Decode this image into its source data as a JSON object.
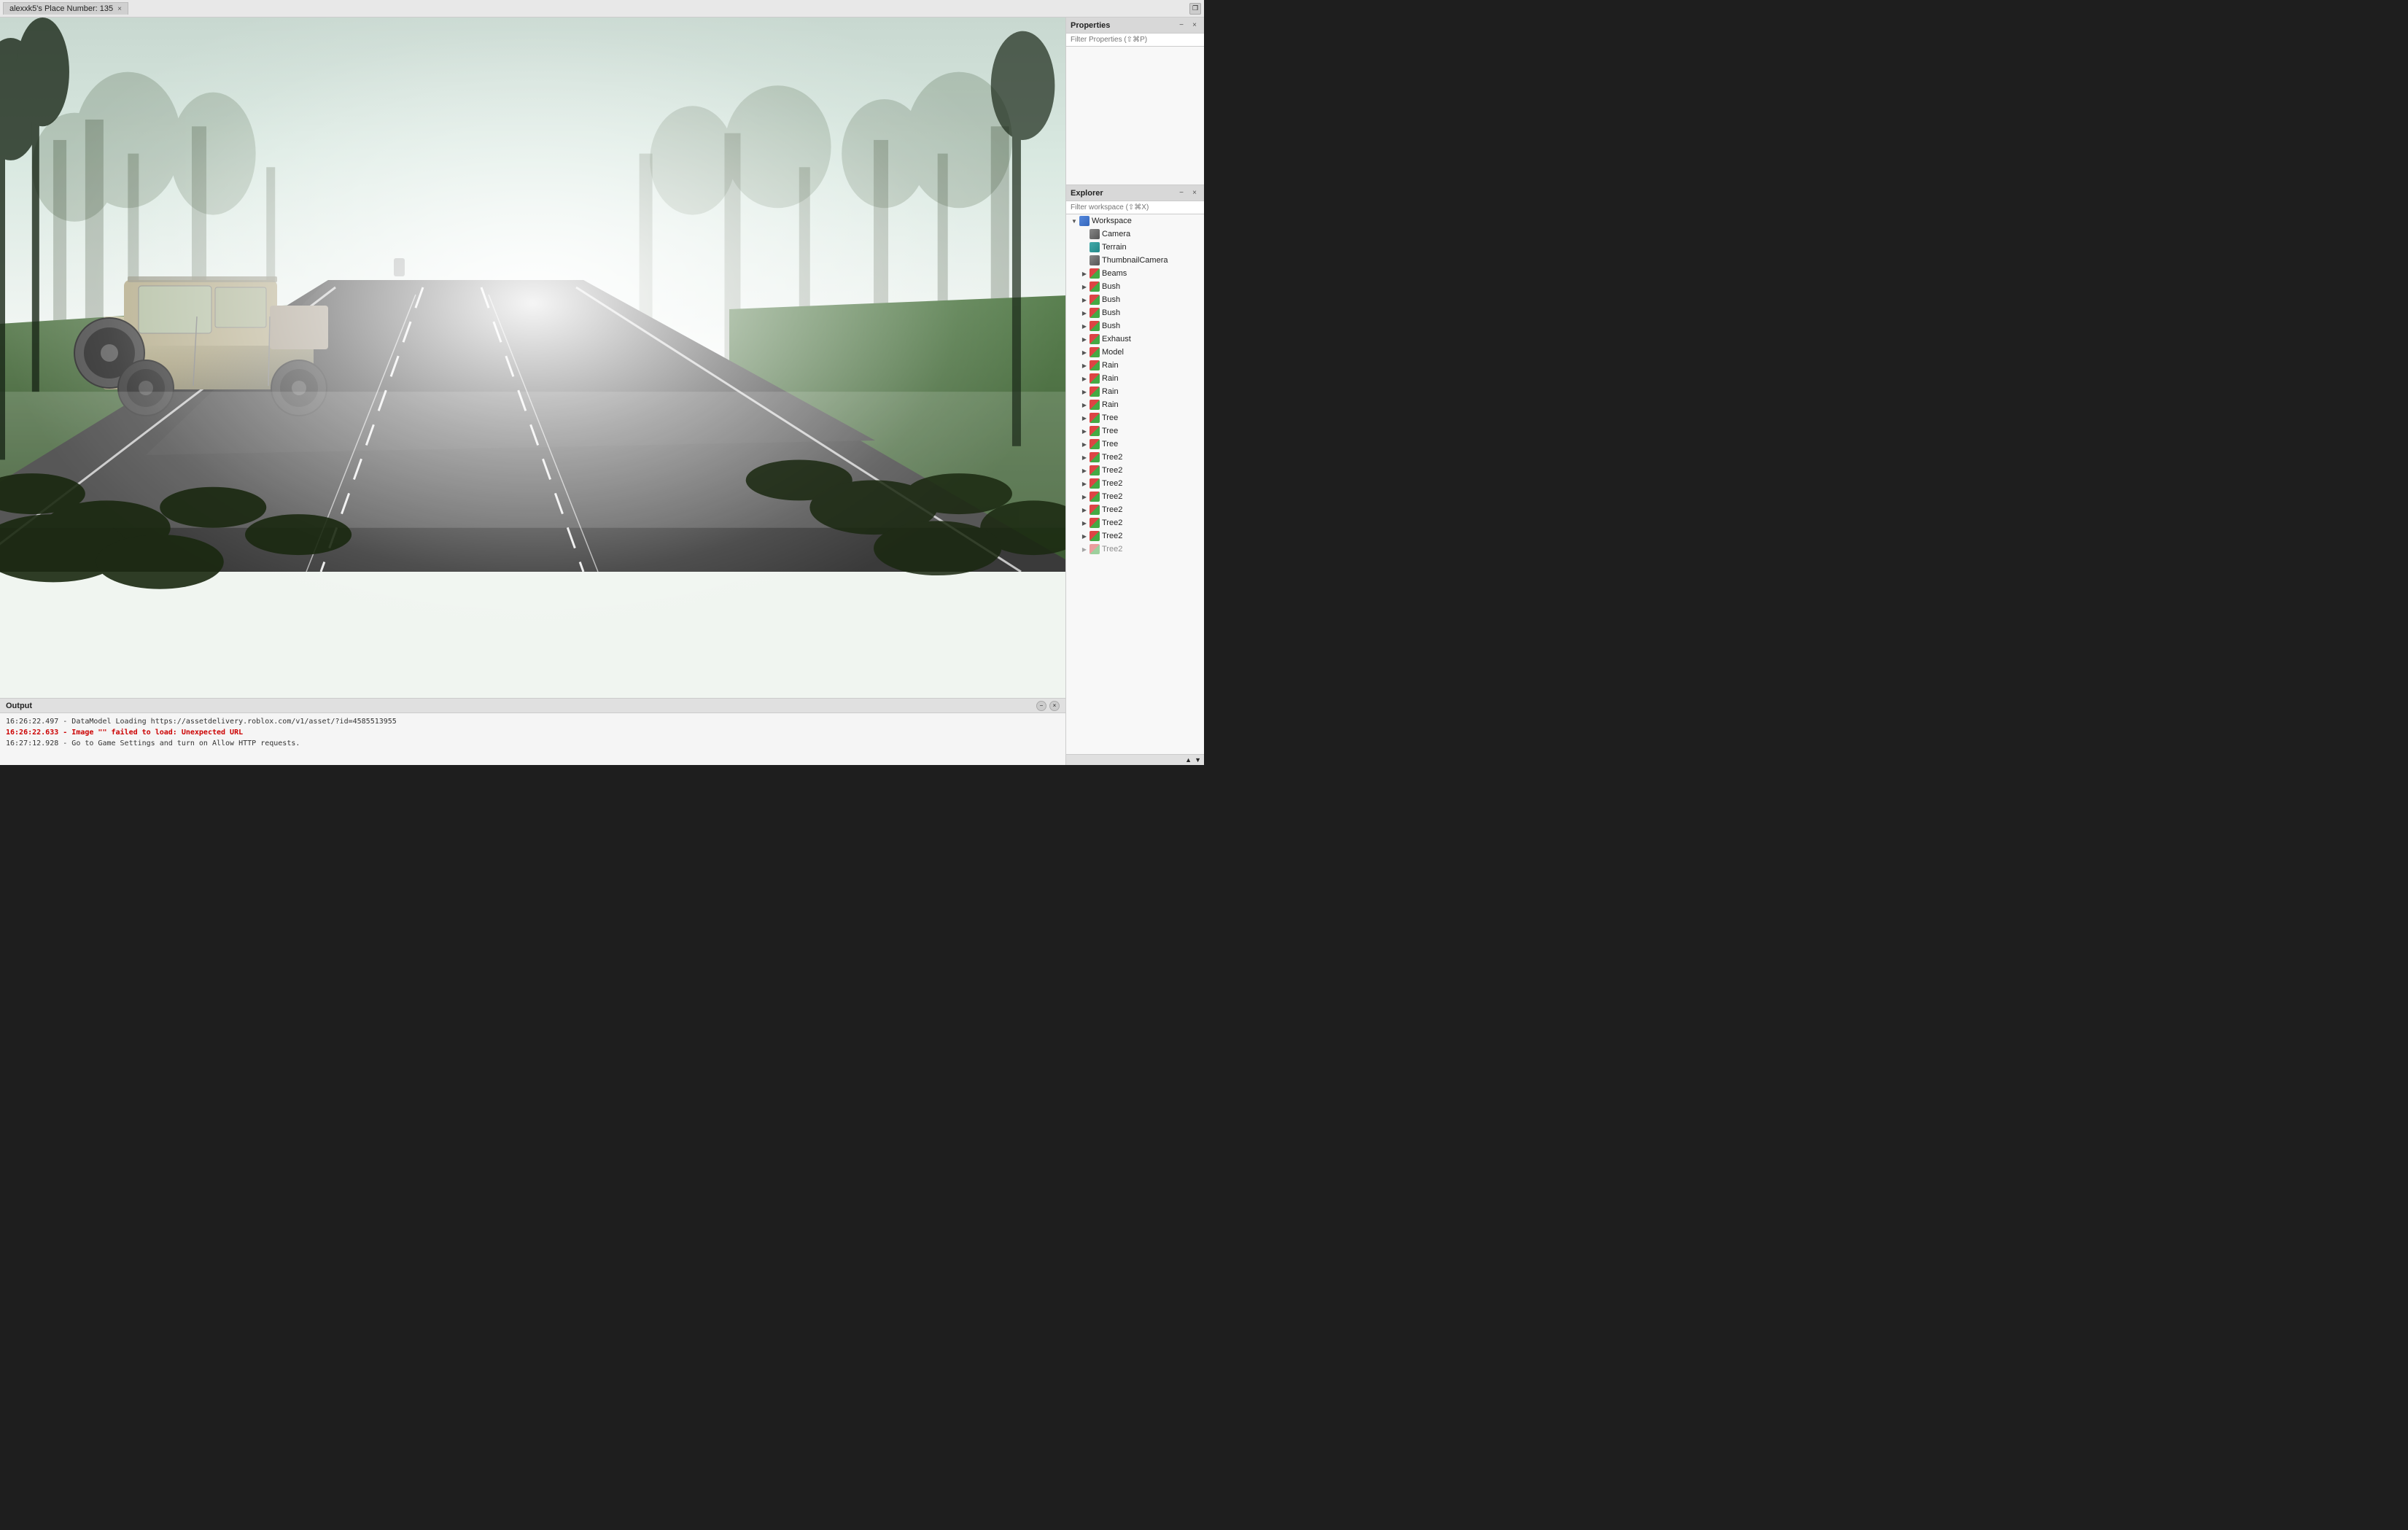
{
  "window": {
    "title": "alexxk5's Place Number: 135",
    "close_icon": "×"
  },
  "title_bar": {
    "tab_label": "alexxk5's Place Number: 135",
    "maximize_icon": "⬜",
    "restore_icon": "❐"
  },
  "properties_panel": {
    "title": "Properties",
    "filter_placeholder": "Filter Properties (⇧⌘P)",
    "close_icon": "×",
    "minimize_icon": "−"
  },
  "explorer_panel": {
    "title": "Explorer",
    "filter_placeholder": "Filter workspace (⇧⌘X)",
    "close_icon": "×",
    "minimize_icon": "−",
    "scroll_up": "▲",
    "scroll_down": "▼"
  },
  "output_panel": {
    "title": "Output",
    "minimize_icon": "−",
    "close_icon": "×",
    "lines": [
      {
        "type": "info",
        "text": "16:26:22.497 - DataModel Loading https://assetdelivery.roblox.com/v1/asset/?id=4585513955"
      },
      {
        "type": "error",
        "text": "16:26:22.633 - Image \"\" failed to load: Unexpected URL"
      },
      {
        "type": "info",
        "text": "16:27:12.928 - Go to Game Settings and turn on Allow HTTP requests."
      }
    ]
  },
  "workspace_tree": {
    "workspace_label": "Workspace",
    "items": [
      {
        "id": "camera",
        "label": "Camera",
        "icon": "camera",
        "indent": 2,
        "expandable": false
      },
      {
        "id": "terrain",
        "label": "Terrain",
        "icon": "terrain",
        "indent": 2,
        "expandable": false
      },
      {
        "id": "thumbnailcamera",
        "label": "ThumbnailCamera",
        "icon": "camera",
        "indent": 2,
        "expandable": false
      },
      {
        "id": "beams",
        "label": "Beams",
        "icon": "model",
        "indent": 2,
        "expandable": true
      },
      {
        "id": "bush1",
        "label": "Bush",
        "icon": "model",
        "indent": 2,
        "expandable": true
      },
      {
        "id": "bush2",
        "label": "Bush",
        "icon": "model",
        "indent": 2,
        "expandable": true
      },
      {
        "id": "bush3",
        "label": "Bush",
        "icon": "model",
        "indent": 2,
        "expandable": true
      },
      {
        "id": "bush4",
        "label": "Bush",
        "icon": "model",
        "indent": 2,
        "expandable": true
      },
      {
        "id": "exhaust",
        "label": "Exhaust",
        "icon": "model",
        "indent": 2,
        "expandable": true
      },
      {
        "id": "model",
        "label": "Model",
        "icon": "model",
        "indent": 2,
        "expandable": true
      },
      {
        "id": "rain1",
        "label": "Rain",
        "icon": "model",
        "indent": 2,
        "expandable": true
      },
      {
        "id": "rain2",
        "label": "Rain",
        "icon": "model",
        "indent": 2,
        "expandable": true
      },
      {
        "id": "rain3",
        "label": "Rain",
        "icon": "model",
        "indent": 2,
        "expandable": true
      },
      {
        "id": "rain4",
        "label": "Rain",
        "icon": "model",
        "indent": 2,
        "expandable": true
      },
      {
        "id": "tree1",
        "label": "Tree",
        "icon": "model",
        "indent": 2,
        "expandable": true
      },
      {
        "id": "tree2",
        "label": "Tree",
        "icon": "model",
        "indent": 2,
        "expandable": true
      },
      {
        "id": "tree3",
        "label": "Tree",
        "icon": "model",
        "indent": 2,
        "expandable": true
      },
      {
        "id": "tree2_1",
        "label": "Tree2",
        "icon": "model",
        "indent": 2,
        "expandable": true
      },
      {
        "id": "tree2_2",
        "label": "Tree2",
        "icon": "model",
        "indent": 2,
        "expandable": true
      },
      {
        "id": "tree2_3",
        "label": "Tree2",
        "icon": "model",
        "indent": 2,
        "expandable": true
      },
      {
        "id": "tree2_4",
        "label": "Tree2",
        "icon": "model",
        "indent": 2,
        "expandable": true
      },
      {
        "id": "tree2_5",
        "label": "Tree2",
        "icon": "model",
        "indent": 2,
        "expandable": true
      },
      {
        "id": "tree2_6",
        "label": "Tree2",
        "icon": "model",
        "indent": 2,
        "expandable": true
      },
      {
        "id": "tree2_7",
        "label": "Tree2",
        "icon": "model",
        "indent": 2,
        "expandable": true
      }
    ]
  }
}
